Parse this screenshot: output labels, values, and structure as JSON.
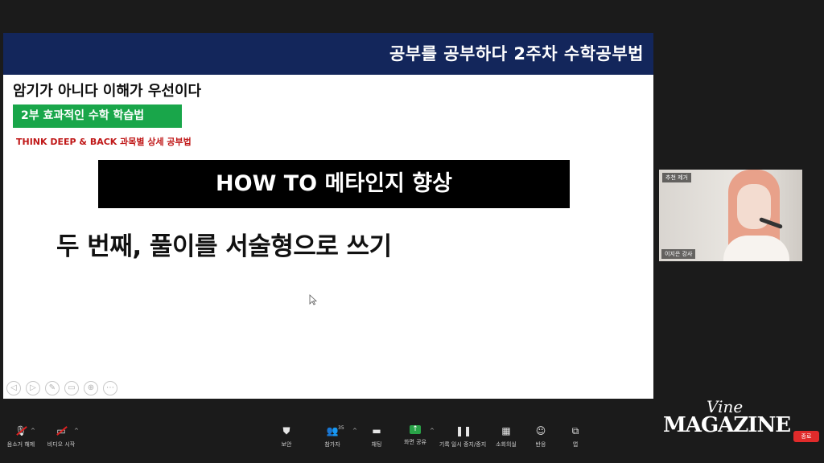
{
  "slide": {
    "header_title": "공부를 공부하다 2주차 수학공부법",
    "subtitle": "암기가 아니다 이해가 우선이다",
    "green_label": "2부 효과적인 수학 학습법",
    "red_caption": "THINK DEEP & BACK 과목별 상세 공부법",
    "banner": "HOW TO 메타인지 향상",
    "main_line": "두 번째, 풀이를 서술형으로 쓰기",
    "controls": [
      "◁",
      "▷",
      "✎",
      "▭",
      "⊕",
      "⋯"
    ]
  },
  "video": {
    "top_tag": "추천 제거",
    "name_tag": "이지은 강사"
  },
  "toolbar": {
    "mute": "음소거 해제",
    "video": "비디오 시작",
    "security": "보안",
    "participants": "참가자",
    "participants_count": "35",
    "chat": "채팅",
    "share": "화면 공유",
    "record": "기록 일시 중지/중지",
    "breakout": "소회의실",
    "reactions": "반응",
    "apps": "앱"
  },
  "logo": {
    "vine": "Vine",
    "magazine": "MAGAZINE"
  },
  "end_button": "종료",
  "colors": {
    "header_bg": "#13265b",
    "green": "#19a64a",
    "red_text": "#c01818",
    "share_green": "#29a348",
    "end_red": "#e02b2b"
  }
}
